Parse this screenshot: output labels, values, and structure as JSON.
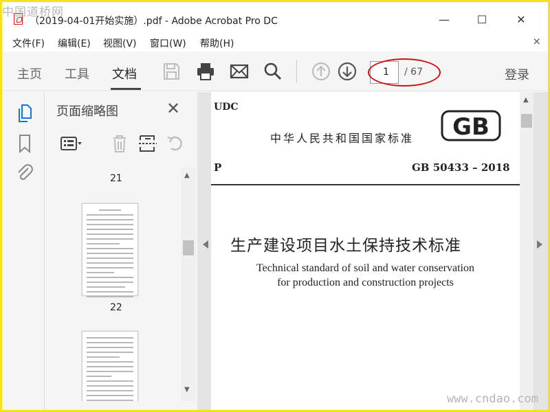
{
  "watermark": {
    "top": "中国道桥网",
    "bottom": "www.cndao.com"
  },
  "titlebar": {
    "title": "（2019-04-01开始实施）.pdf - Adobe Acrobat Pro DC",
    "pdf_icon": "pdf-file-icon",
    "minimize": "—",
    "maximize": "☐",
    "close": "✕"
  },
  "menu": {
    "items": [
      "文件(F)",
      "编辑(E)",
      "视图(V)",
      "窗口(W)",
      "帮助(H)"
    ],
    "close": "×"
  },
  "toolbar": {
    "tabs": [
      "主页",
      "工具",
      "文档"
    ],
    "active_tab": "文档",
    "icons": [
      "save-icon",
      "print-icon",
      "email-icon",
      "search-icon",
      "page-up-icon",
      "page-down-icon"
    ],
    "page_current": "1",
    "page_total": "/ 67",
    "login": "登录",
    "highlight_color": "#d01010"
  },
  "nav_icons": [
    "page-thumbnails-icon",
    "bookmark-icon",
    "attachment-icon"
  ],
  "thumb_panel": {
    "title": "页面缩略图",
    "close": "✕",
    "tool_icons": [
      "thumbnail-options-icon",
      "delete-page-icon",
      "extract-page-icon",
      "rotate-page-icon"
    ],
    "labels": [
      "21",
      "22"
    ]
  },
  "document": {
    "udc": "UDC",
    "country": "中华人民共和国国家标准",
    "logo": "GB",
    "p_code": "P",
    "std_no": "GB 50433 – 2018",
    "title_cn": "生产建设项目水土保持技术标准",
    "title_en_1": "Technical standard of soil and water conservation",
    "title_en_2": "for production and construction projects"
  },
  "colors": {
    "accent": "#1473e6",
    "background": "#f5e31a",
    "highlight": "#d01010"
  }
}
